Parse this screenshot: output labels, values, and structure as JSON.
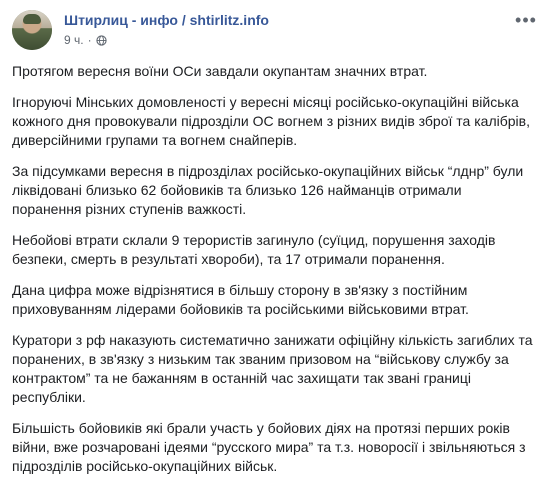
{
  "post": {
    "page_name": "Штирлиц - инфо / shtirlitz.info",
    "timestamp": "9 ч.",
    "privacy_icon": "globe-icon",
    "more_icon": "more-options-icon",
    "paragraphs": [
      "Протягом вересня воїни ОСи завдали окупантам значних втрат.",
      "Ігноруючі Мінських домовленості у вересні місяці російсько-окупаційні війська кожного дня провокували підрозділи ОС вогнем з різних видів зброї та калібрів, диверсійними групами та вогнем снайперів.",
      "За підсумками вересня в підрозділах російсько-окупаційних військ “лднр” були ліквідовані близько 62 бойовиків та близько 126 найманців отримали поранення різних ступенів важкості.",
      "Небойові втрати склали 9 терористів загинуло (суїцид, порушення заходів безпеки, смерть в результаті хвороби), та 17 отримали поранення.",
      "Дана цифра може відрізнятися в більшу сторону в зв'язку з постійним приховуванням лідерами бойовиків та російськими військовими втрат.",
      "Куратори з рф наказують систематично занижати офіційну кількість загиблих та поранених, в зв'язку з низьким так званим призовом на “військову службу за контрактом” та не бажанням в останній час захищати так звані границі республіки.",
      "Більшість бойовиків які брали участь у бойових діях на протязі перших років війни, вже розчаровані ідеями “русского мира” та т.з. новоросії і звільняються з підрозділів російсько-окупаційних військ."
    ]
  }
}
